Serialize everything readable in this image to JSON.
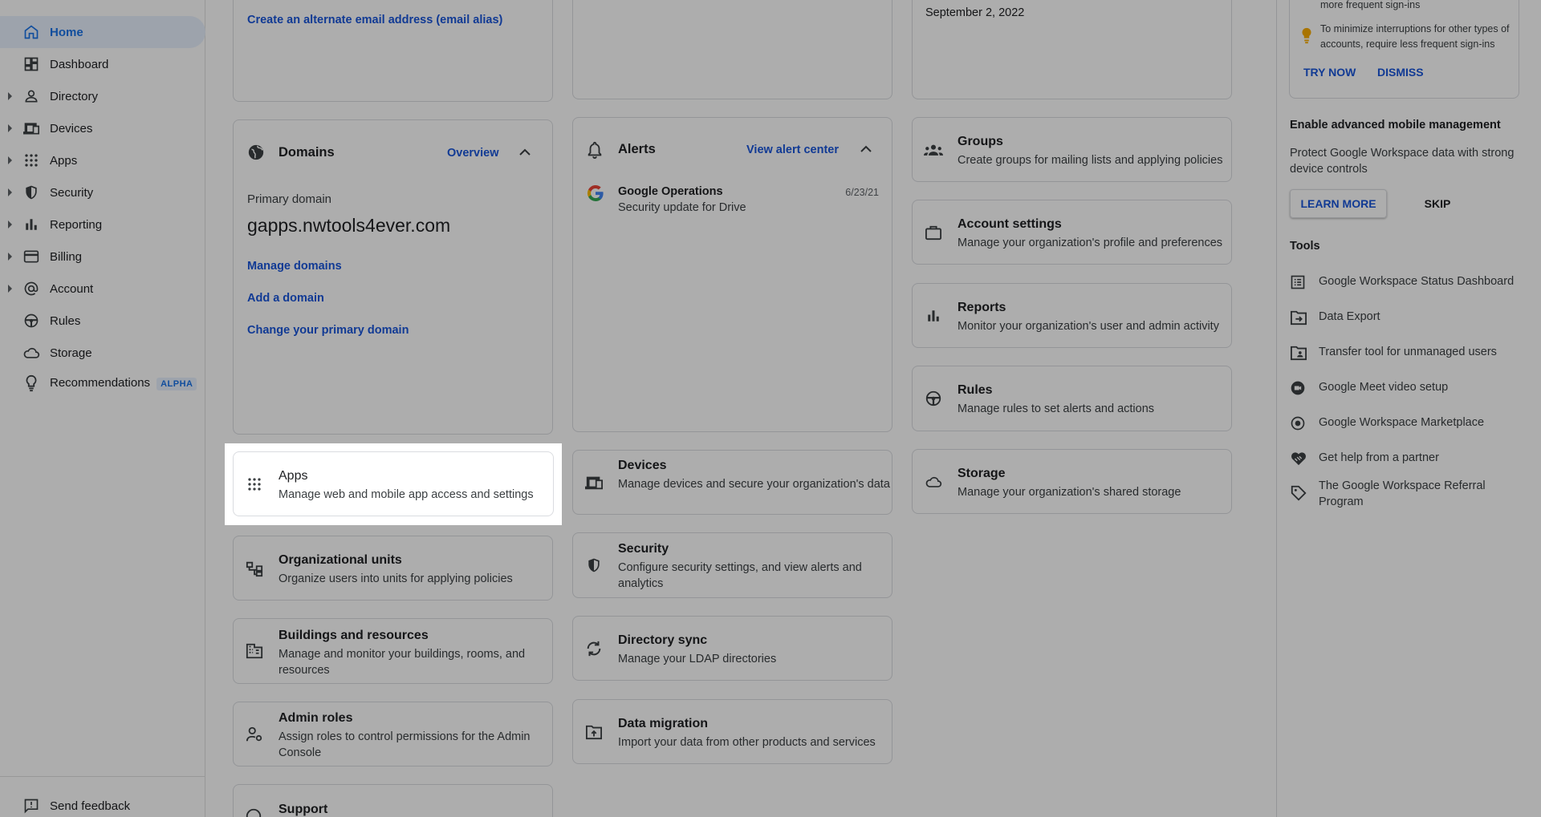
{
  "sidebar": {
    "items": [
      {
        "label": "Home",
        "icon": "home-icon",
        "active": true,
        "expandable": false
      },
      {
        "label": "Dashboard",
        "icon": "dashboard-icon",
        "expandable": false
      },
      {
        "label": "Directory",
        "icon": "person-icon",
        "expandable": true
      },
      {
        "label": "Devices",
        "icon": "devices-icon",
        "expandable": true
      },
      {
        "label": "Apps",
        "icon": "apps-grid-icon",
        "expandable": true
      },
      {
        "label": "Security",
        "icon": "shield-icon",
        "expandable": true
      },
      {
        "label": "Reporting",
        "icon": "bar-chart-icon",
        "expandable": true
      },
      {
        "label": "Billing",
        "icon": "credit-card-icon",
        "expandable": true
      },
      {
        "label": "Account",
        "icon": "at-sign-icon",
        "expandable": true
      },
      {
        "label": "Rules",
        "icon": "steering-wheel-icon",
        "expandable": false
      },
      {
        "label": "Storage",
        "icon": "cloud-icon",
        "expandable": false
      },
      {
        "label": "Recommendations",
        "icon": "lightbulb-icon",
        "expandable": false,
        "badge": "ALPHA"
      }
    ],
    "feedback_label": "Send feedback"
  },
  "col1": {
    "top_link": "Create an alternate email address (email alias)",
    "domains": {
      "title": "Domains",
      "overview_link": "Overview",
      "primary_label": "Primary domain",
      "primary_domain": "gapps.nwtools4ever.com",
      "links": [
        "Manage domains",
        "Add a domain",
        "Change your primary domain"
      ]
    },
    "apps": {
      "title": "Apps",
      "desc": "Manage web and mobile app access and settings"
    },
    "org_units": {
      "title": "Organizational units",
      "desc": "Organize users into units for applying policies"
    },
    "buildings": {
      "title": "Buildings and resources",
      "desc": "Manage and monitor your buildings, rooms, and resources"
    },
    "admin_roles": {
      "title": "Admin roles",
      "desc": "Assign roles to control permissions for the Admin Console"
    },
    "support": {
      "title": "Support"
    }
  },
  "col2": {
    "alerts": {
      "title": "Alerts",
      "view_link": "View alert center",
      "items": [
        {
          "source": "Google Operations",
          "text": "Security update for Drive",
          "date": "6/23/21"
        }
      ]
    },
    "devices": {
      "title": "Devices",
      "desc": "Manage devices and secure your organization's data"
    },
    "security": {
      "title": "Security",
      "desc": "Configure security settings, and view alerts and analytics"
    },
    "directory_sync": {
      "title": "Directory sync",
      "desc": "Manage your LDAP directories"
    },
    "data_migration": {
      "title": "Data migration",
      "desc": "Import your data from other products and services"
    }
  },
  "col3": {
    "top_date": "September 2, 2022",
    "groups": {
      "title": "Groups",
      "desc": "Create groups for mailing lists and applying policies"
    },
    "account_settings": {
      "title": "Account settings",
      "desc": "Manage your organization's profile and preferences"
    },
    "reports": {
      "title": "Reports",
      "desc": "Monitor your organization's user and admin activity"
    },
    "rules": {
      "title": "Rules",
      "desc": "Manage rules to set alerts and actions"
    },
    "storage": {
      "title": "Storage",
      "desc": "Manage your organization's shared storage"
    }
  },
  "right_panel": {
    "tip_partial": "more frequent sign-ins",
    "tip_text": "To minimize interruptions for other types of accounts, require less frequent sign-ins",
    "try_now": "TRY NOW",
    "dismiss": "DISMISS",
    "mobile_heading": "Enable advanced mobile management",
    "mobile_text": "Protect Google Workspace data with strong device controls",
    "learn_more": "LEARN MORE",
    "skip": "SKIP",
    "tools_heading": "Tools",
    "tools": [
      {
        "label": "Google Workspace Status Dashboard",
        "icon": "dashboard-list-icon"
      },
      {
        "label": "Data Export",
        "icon": "folder-export-icon"
      },
      {
        "label": "Transfer tool for unmanaged users",
        "icon": "folder-user-icon"
      },
      {
        "label": "Google Meet video setup",
        "icon": "meet-video-icon"
      },
      {
        "label": "Google Workspace Marketplace",
        "icon": "marketplace-icon"
      },
      {
        "label": "Get help from a partner",
        "icon": "handshake-heart-icon"
      },
      {
        "label": "The Google Workspace Referral Program",
        "icon": "tag-icon"
      }
    ]
  },
  "colors": {
    "accent": "#1a73e8",
    "link": "#1a56db",
    "overlay": "rgba(0,0,0,0.32)"
  }
}
